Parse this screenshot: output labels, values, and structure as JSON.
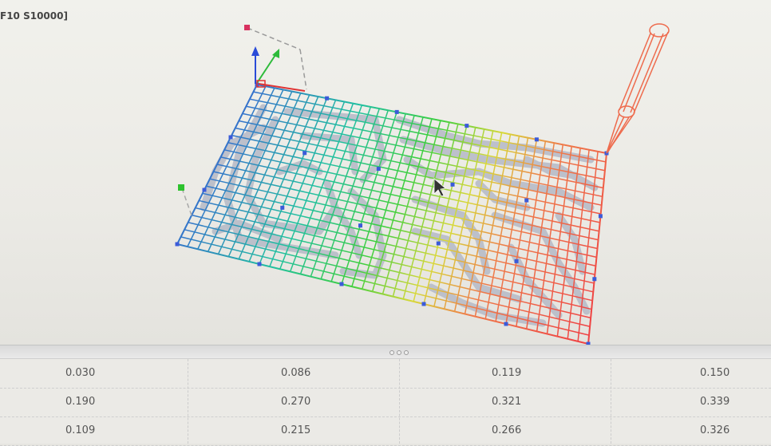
{
  "viewport": {
    "gcode_fragment": "F10 S10000]",
    "tool_icon": "cnc-tool-bit-icon",
    "cursor_icon": "mouse-pointer-icon",
    "axis_icon": "xyz-axis-gizmo-icon"
  },
  "colors": {
    "grid_low": "#3b5bd9",
    "grid_mid": "#22c55e",
    "grid_high": "#ef4444",
    "toolpath": "#b8bcc8",
    "tool": "#ee6b4d",
    "probe_points": "#3b5bd9"
  },
  "splitter": {
    "icon": "drag-handle-icon"
  },
  "height_table": {
    "rows": [
      [
        "0.030",
        "0.086",
        "0.119",
        "0.150"
      ],
      [
        "0.190",
        "0.270",
        "0.321",
        "0.339"
      ],
      [
        "0.109",
        "0.215",
        "0.266",
        "0.326"
      ]
    ]
  }
}
